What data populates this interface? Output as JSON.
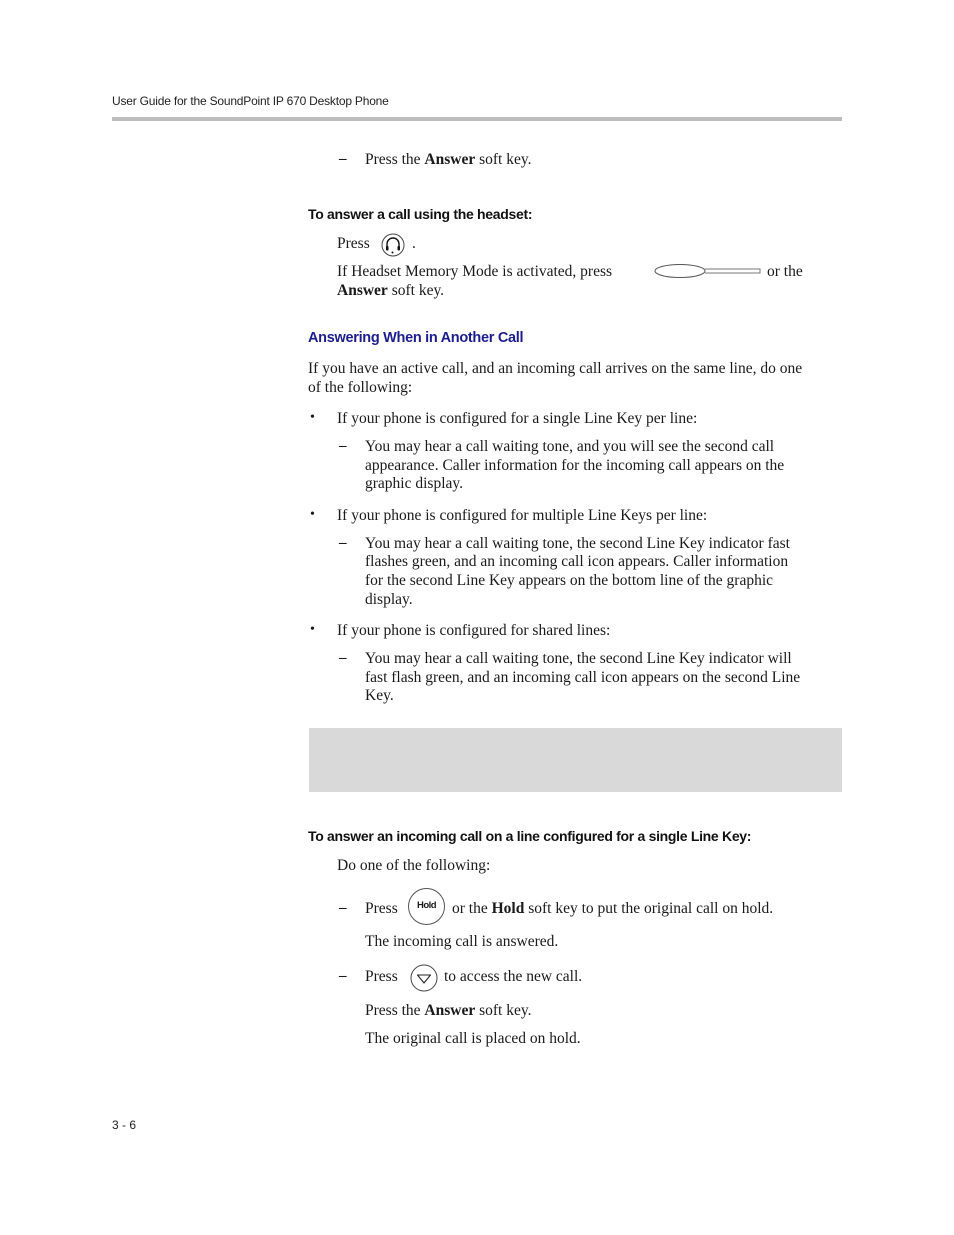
{
  "header": {
    "running_title": "User Guide for the SoundPoint IP 670 Desktop Phone"
  },
  "top_step": {
    "marker": "–",
    "pre": "Press the ",
    "bold": "Answer",
    "post": " soft key."
  },
  "headset_procedure": {
    "heading": "To answer a call using the headset:",
    "press_label": "Press",
    "press_suffix": ".",
    "headset_key_icon": "headset-key-icon",
    "memory_mode_pre": "If Headset Memory Mode is activated, press",
    "line_key_icon": "line-key-icon",
    "memory_mode_post": "or the",
    "answer_bold": "Answer",
    "answer_post": " soft key."
  },
  "section": {
    "title": "Answering When in Another Call",
    "intro_line1": "If you have an active call, and an incoming call arrives on the same line, do one",
    "intro_line2": "of the following:",
    "bullets": [
      {
        "marker": "•",
        "text": "If your phone is configured for a single Line Key per line:",
        "sub_marker": "–",
        "sub_lines": [
          "You may hear a call waiting tone, and you will see the second call",
          "appearance. Caller information for the incoming call appears on the",
          "graphic display."
        ]
      },
      {
        "marker": "•",
        "text": "If your phone is configured for multiple Line Keys per line:",
        "sub_marker": "–",
        "sub_lines": [
          "You may hear a call waiting tone, the second Line Key indicator fast",
          "flashes green, and an incoming call icon appears. Caller information",
          "for the second Line Key appears on the bottom line of the graphic",
          "display."
        ]
      },
      {
        "marker": "•",
        "text": "If your phone is configured for shared lines:",
        "sub_marker": "–",
        "sub_lines": [
          "You may hear a call waiting tone, the second Line Key indicator will",
          "fast flash green, and an incoming call icon appears on the second Line",
          "Key."
        ]
      }
    ]
  },
  "single_line_procedure": {
    "heading": "To answer an incoming call on a line configured for a single Line Key:",
    "intro": "Do one of the following:",
    "option1": {
      "marker": "–",
      "press_label": "Press",
      "hold_key_label": "Hold",
      "mid_pre": "or the ",
      "mid_bold": "Hold",
      "mid_post": " soft key to put the original call on hold.",
      "result": "The incoming call is answered."
    },
    "option2": {
      "marker": "–",
      "press_label": "Press",
      "down_key_icon": "down-arrow-key-icon",
      "post": "to access the new call.",
      "step2_pre": "Press the ",
      "step2_bold": "Answer",
      "step2_post": " soft key.",
      "result": "The original call is placed on hold."
    }
  },
  "footer": {
    "page_number": "3 - 6"
  }
}
